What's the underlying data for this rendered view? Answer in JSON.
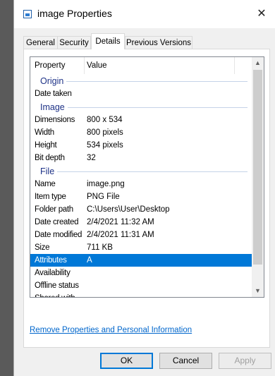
{
  "window": {
    "title": "image Properties",
    "close_glyph": "✕",
    "icon": "image-file-icon"
  },
  "tabs": [
    {
      "label": "General",
      "active": false
    },
    {
      "label": "Security",
      "active": false
    },
    {
      "label": "Details",
      "active": true
    },
    {
      "label": "Previous Versions",
      "active": false
    }
  ],
  "list": {
    "header": {
      "property": "Property",
      "value": "Value"
    },
    "groups": {
      "origin": "Origin",
      "image": "Image",
      "file": "File"
    },
    "origin_rows": [
      {
        "key": "Date taken",
        "value": ""
      }
    ],
    "image_rows": [
      {
        "key": "Dimensions",
        "value": "800 x 534"
      },
      {
        "key": "Width",
        "value": "800 pixels"
      },
      {
        "key": "Height",
        "value": "534 pixels"
      },
      {
        "key": "Bit depth",
        "value": "32"
      }
    ],
    "file_rows": [
      {
        "key": "Name",
        "value": "image.png"
      },
      {
        "key": "Item type",
        "value": "PNG File"
      },
      {
        "key": "Folder path",
        "value": "C:\\Users\\User\\Desktop"
      },
      {
        "key": "Date created",
        "value": "2/4/2021 11:32 AM"
      },
      {
        "key": "Date modified",
        "value": "2/4/2021 11:31 AM"
      },
      {
        "key": "Size",
        "value": "711 KB"
      },
      {
        "key": "Attributes",
        "value": "A",
        "selected": true
      },
      {
        "key": "Availability",
        "value": ""
      },
      {
        "key": "Offline status",
        "value": ""
      },
      {
        "key": "Shared with",
        "value": ""
      }
    ]
  },
  "remove_link": "Remove Properties and Personal Information",
  "buttons": {
    "ok": "OK",
    "cancel": "Cancel",
    "apply": "Apply"
  },
  "colors": {
    "selection": "#0078d7",
    "group_text": "#1e3287",
    "link": "#0066cc"
  }
}
